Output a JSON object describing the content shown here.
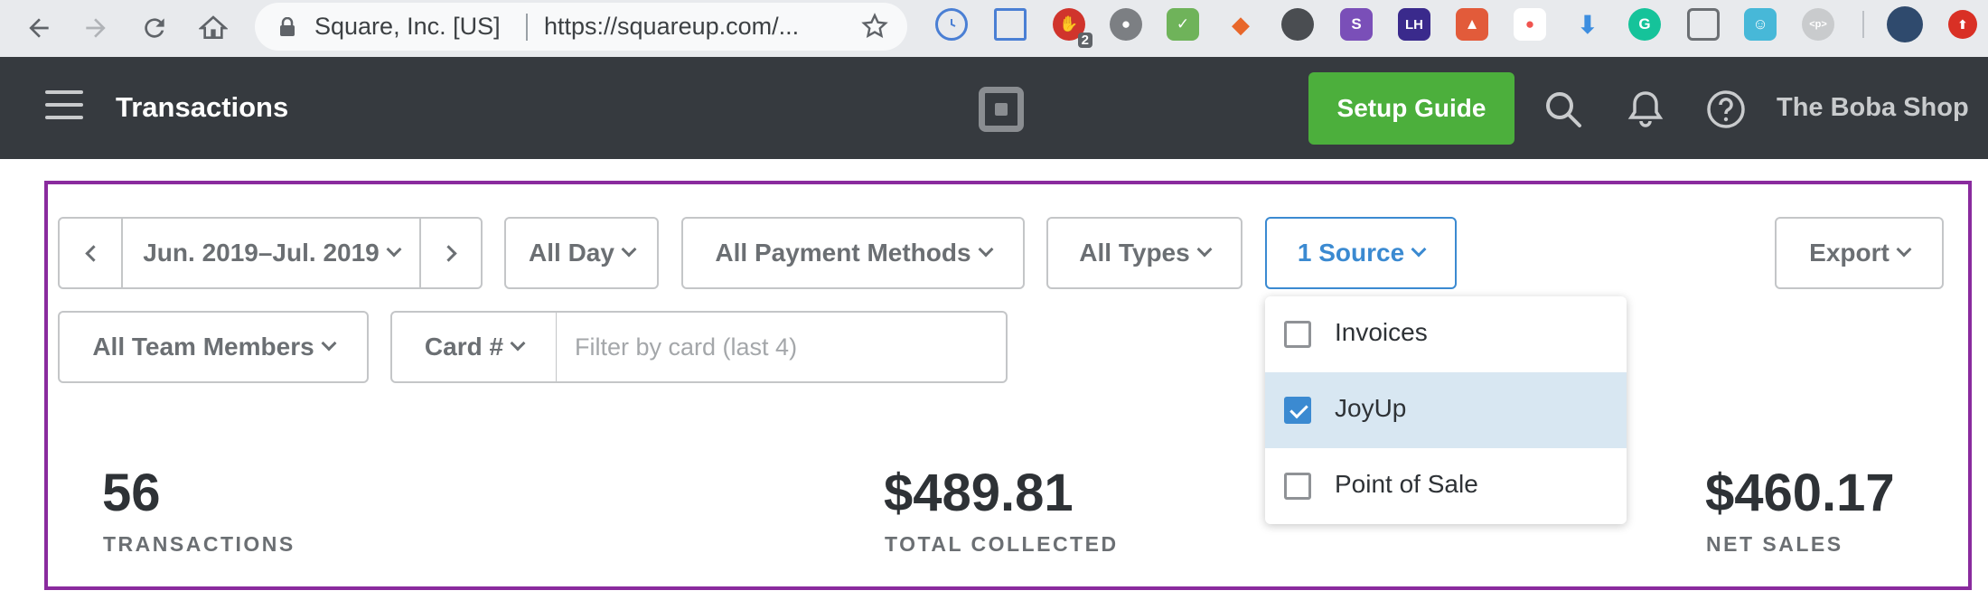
{
  "browser": {
    "site_name": "Square, Inc. [US]",
    "url": "https://squareup.com/...",
    "extension_badge": "2",
    "extensions": [
      "clock-icon",
      "window-icon",
      "adblock-icon",
      "film-icon",
      "mail-check-icon",
      "fox-icon",
      "bomb-icon",
      "s-icon",
      "lh-icon",
      "flame-icon",
      "tinder-icon",
      "download-icon",
      "grammarly-icon",
      "pocket-icon",
      "ghost-icon",
      "p-tag-icon",
      "profile-avatar",
      "update-icon"
    ],
    "extension_letters": {
      "s": "S",
      "lh": "LH",
      "p": "<p>"
    }
  },
  "header": {
    "title": "Transactions",
    "setup_guide": "Setup Guide",
    "shop_name": "The Boba Shop",
    "brand_color": "#4caf3c"
  },
  "filters": {
    "date_range": "Jun. 2019–Jul. 2019",
    "time": "All Day",
    "payment_methods": "All Payment Methods",
    "types": "All Types",
    "source": "1 Source",
    "export": "Export",
    "team_members": "All Team Members",
    "card_select": "Card #",
    "card_placeholder": "Filter by card (last 4)"
  },
  "source_dropdown": {
    "options": [
      {
        "label": "Invoices",
        "checked": false
      },
      {
        "label": "JoyUp",
        "checked": true
      },
      {
        "label": "Point of Sale",
        "checked": false
      }
    ]
  },
  "stats": [
    {
      "value": "56",
      "label": "TRANSACTIONS"
    },
    {
      "value": "$489.81",
      "label": "TOTAL COLLECTED"
    },
    {
      "value": "$460.17",
      "label": "NET SALES"
    }
  ],
  "colors": {
    "accent": "#3b8ad1",
    "highlight_frame": "#8a2b9e",
    "header_bg": "#363a3f"
  }
}
